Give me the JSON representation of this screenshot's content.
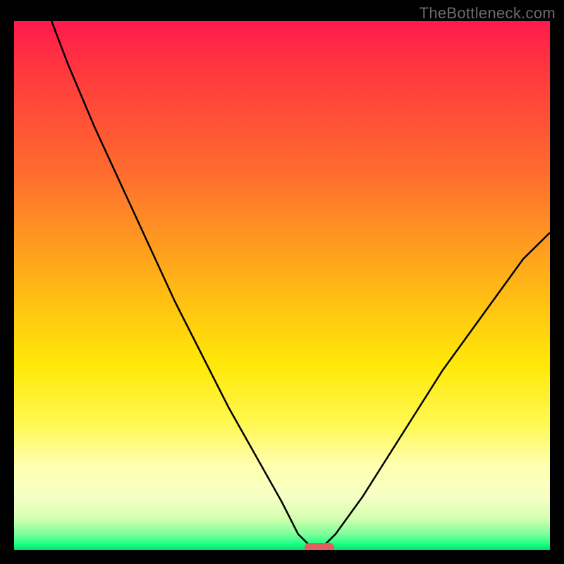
{
  "watermark": "TheBottleneck.com",
  "chart_data": {
    "type": "line",
    "title": "",
    "xlabel": "",
    "ylabel": "",
    "xlim": [
      0,
      100
    ],
    "ylim": [
      0,
      100
    ],
    "grid": false,
    "legend": false,
    "x": [
      7,
      10,
      15,
      20,
      25,
      30,
      35,
      40,
      45,
      50,
      53,
      55,
      57,
      60,
      65,
      70,
      75,
      80,
      85,
      90,
      95,
      100
    ],
    "values": [
      100,
      92,
      80,
      69,
      58,
      47,
      37,
      27,
      18,
      9,
      3,
      1,
      0,
      3,
      10,
      18,
      26,
      34,
      41,
      48,
      55,
      60
    ],
    "minimum_x": 57,
    "marker": {
      "x": 57,
      "y": 0
    }
  },
  "colors": {
    "gradient_top": "#ff1a4d",
    "gradient_mid": "#ffe808",
    "gradient_bottom": "#00e070",
    "marker": "#e06060",
    "curve": "#000000",
    "frame": "#000000"
  }
}
